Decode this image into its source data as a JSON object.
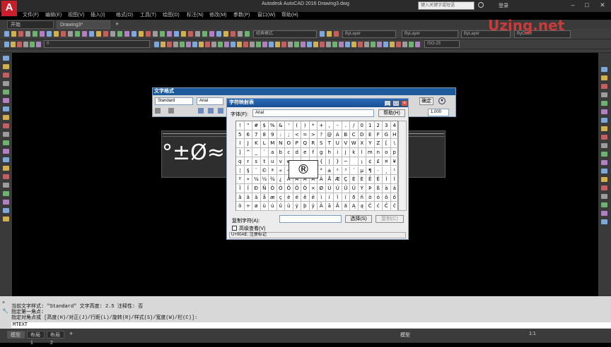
{
  "app": {
    "logo": "A",
    "title": "Autodesk AutoCAD 2016    Drawing3.dwg",
    "search_placeholder": "键入关键字或短语",
    "login": "登录"
  },
  "menu": [
    "文件(F)",
    "编辑(E)",
    "视图(V)",
    "插入(I)",
    "格式(O)",
    "工具(T)",
    "绘图(D)",
    "标注(N)",
    "修改(M)",
    "参数(P)",
    "窗口(W)",
    "帮助(H)"
  ],
  "doc_tabs": [
    "开始",
    "Drawing3*"
  ],
  "toolbars": {
    "workspace": "经典模式",
    "layer": "0",
    "color": "ByLayer",
    "linetype": "ByLayer",
    "lineweight": "ByLayer",
    "plotstyle": "ByColor",
    "dimstyle": "ISO-25"
  },
  "text_format": {
    "title": "文字格式",
    "style": "Standard",
    "font": "Arial",
    "ok_label": "确定",
    "width_factor": "1.000"
  },
  "editor_text": "°±Ø≈",
  "charmap": {
    "title": "字符映射表",
    "font_label": "字体(F):",
    "font_value": "Arial",
    "help_label": "帮助(H)",
    "rows": [
      [
        "!",
        "\"",
        "#",
        "$",
        "%",
        "&",
        "'",
        "(",
        ")",
        "*",
        "+",
        ",",
        "-",
        ".",
        "/",
        "0",
        "1",
        "2",
        "3",
        "4"
      ],
      [
        "5",
        "6",
        "7",
        "8",
        "9",
        ":",
        ";",
        "<",
        "=",
        ">",
        "?",
        "@",
        "A",
        "B",
        "C",
        "D",
        "E",
        "F",
        "G",
        "H"
      ],
      [
        "I",
        "J",
        "K",
        "L",
        "M",
        "N",
        "O",
        "P",
        "Q",
        "R",
        "S",
        "T",
        "U",
        "V",
        "W",
        "X",
        "Y",
        "Z",
        "[",
        "\\"
      ],
      [
        "]",
        "^",
        "_",
        "`",
        "a",
        "b",
        "c",
        "d",
        "e",
        "f",
        "g",
        "h",
        "i",
        "j",
        "k",
        "l",
        "m",
        "n",
        "o",
        "p"
      ],
      [
        "q",
        "r",
        "s",
        "t",
        "u",
        "v",
        "w",
        "x",
        "y",
        "z",
        "{",
        "|",
        "}",
        "~",
        " ",
        "¡",
        "¢",
        "£",
        "¤",
        "¥"
      ],
      [
        "¦",
        "§",
        "¨",
        "©",
        "ª",
        "«",
        "¬",
        "-",
        "®",
        "¯",
        "°",
        "±",
        "²",
        "³",
        "´",
        "µ",
        "¶",
        "·",
        "¸",
        "¹"
      ],
      [
        "º",
        "»",
        "¼",
        "½",
        "¾",
        "¿",
        "À",
        "Á",
        "Â",
        "Ã",
        "Ä",
        "Å",
        "Æ",
        "Ç",
        "È",
        "É",
        "Ê",
        "Ë",
        "Ì",
        "Í"
      ],
      [
        "Î",
        "Ï",
        "Ð",
        "Ñ",
        "Ò",
        "Ó",
        "Ô",
        "Õ",
        "Ö",
        "×",
        "Ø",
        "Ù",
        "Ú",
        "Û",
        "Ü",
        "Ý",
        "Þ",
        "ß",
        "à",
        "á"
      ],
      [
        "â",
        "ã",
        "ä",
        "å",
        "æ",
        "ç",
        "è",
        "é",
        "ê",
        "ë",
        "ì",
        "í",
        "î",
        "ï",
        "ð",
        "ñ",
        "ò",
        "ó",
        "ô",
        "õ"
      ],
      [
        "ö",
        "÷",
        "ø",
        "ù",
        "ú",
        "û",
        "ü",
        "ý",
        "þ",
        "ÿ",
        "Ā",
        "ā",
        "Ă",
        "ă",
        "Ą",
        "ą",
        "Ć",
        "ć",
        "Ĉ",
        "ĉ"
      ]
    ],
    "magnified": "®",
    "copy_label": "复制字符(A):",
    "copy_value": "",
    "select_label": "选择(S)",
    "copy_button_label": "复制(C)",
    "advanced_label": "高级查看(V)",
    "status": "U+00AE: 注册标记"
  },
  "command": {
    "lines": [
      "当前文字样式: \"Standard\"  文字高度:  2.5  注释性:  否",
      "指定第一角点:",
      "指定对角点或 [高度(H)/对正(J)/行距(L)/旋转(R)/样式(S)/宽度(W)/栏(C)]:"
    ],
    "input": "MTEXT"
  },
  "layout_tabs": [
    "模型",
    "布局1",
    "布局2"
  ],
  "status": {
    "mode": "模型",
    "scale": "1:1"
  },
  "watermark": "Uzing.net",
  "colors": {
    "accent": "#c8202a",
    "dialog_title": "#1c5a9c",
    "canvas": "#000000"
  }
}
